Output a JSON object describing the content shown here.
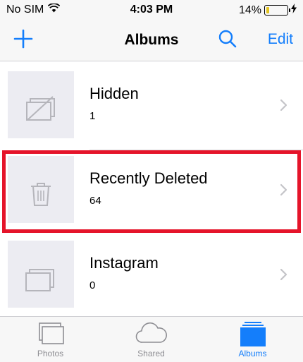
{
  "status_bar": {
    "carrier": "No SIM",
    "time": "4:03 PM",
    "battery_percent": "14%",
    "battery_level": 0.14,
    "icons": [
      "wifi-icon",
      "battery-icon",
      "charging-bolt-icon"
    ]
  },
  "nav": {
    "title": "Albums",
    "edit_label": "Edit",
    "icons": [
      "plus-icon",
      "search-icon"
    ],
    "accent_color": "#147efb"
  },
  "albums": [
    {
      "name": "Hidden",
      "count": "1",
      "icon": "hidden-album-icon"
    },
    {
      "name": "Recently Deleted",
      "count": "64",
      "icon": "trash-icon",
      "highlighted": true
    },
    {
      "name": "Instagram",
      "count": "0",
      "icon": "stacked-photos-icon"
    }
  ],
  "highlight_color": "#e5142a",
  "tabs": [
    {
      "label": "Photos",
      "icon": "photos-icon",
      "active": false
    },
    {
      "label": "Shared",
      "icon": "cloud-icon",
      "active": false
    },
    {
      "label": "Albums",
      "icon": "albums-icon",
      "active": true
    }
  ]
}
